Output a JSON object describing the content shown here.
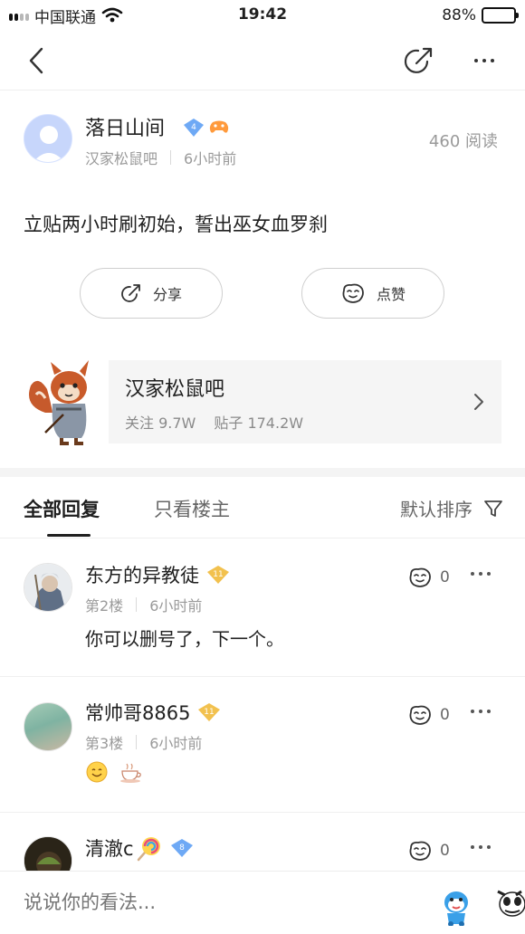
{
  "status_bar": {
    "carrier": "中国联通",
    "time": "19:42",
    "battery": "88%",
    "battery_level": 0.88
  },
  "post": {
    "author_name": "落日山间",
    "author_level": "4",
    "forum_tag": "汉家松鼠吧",
    "time": "6小时前",
    "read_count": "460 阅读",
    "content": "立贴两小时刷初始，誓出巫女血罗刹",
    "share_label": "分享",
    "like_label": "点赞"
  },
  "forum": {
    "name": "汉家松鼠吧",
    "followers": "关注 9.7W",
    "posts": "贴子 174.2W"
  },
  "tabs": {
    "all_replies": "全部回复",
    "owner_only": "只看楼主",
    "sort_label": "默认排序"
  },
  "replies": [
    {
      "name": "东方的异教徒",
      "level": "11",
      "floor": "第2楼",
      "time": "6小时前",
      "content": "你可以删号了，下一个。",
      "likes": "0"
    },
    {
      "name": "常帅哥8865",
      "level": "11",
      "floor": "第3楼",
      "time": "6小时前",
      "content": "",
      "likes": "0"
    },
    {
      "name": "清澈c",
      "level": "8",
      "likes": "0"
    }
  ],
  "comment_bar": {
    "placeholder": "说说你的看法..."
  },
  "colors": {
    "level_badge_blue": "#6ea9f5",
    "level_badge_gold": "#f2c14e",
    "muted_text": "#9a9a9a"
  },
  "icons": [
    "back-icon",
    "share-icon",
    "more-icon",
    "like-icon",
    "chevron-right-icon",
    "filter-icon",
    "signal-icon",
    "wifi-icon",
    "battery-icon"
  ]
}
